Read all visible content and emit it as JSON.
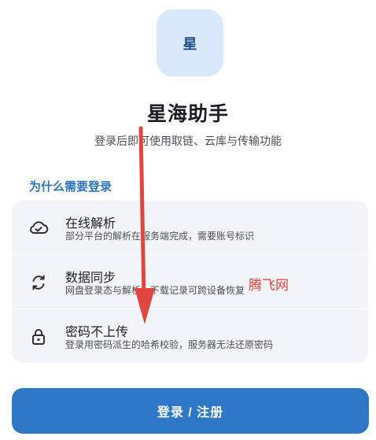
{
  "app": {
    "logo_char": "星",
    "title": "星海助手",
    "subtitle": "登录后即可使用取链、云库与传输功能"
  },
  "section": {
    "title": "为什么需要登录"
  },
  "features": [
    {
      "icon": "cloud-check-icon",
      "title": "在线解析",
      "desc": "部分平台的解析在服务端完成，需要账号标识"
    },
    {
      "icon": "sync-icon",
      "title": "数据同步",
      "desc": "网盘登录态与解析、下载记录可跨设备恢复"
    },
    {
      "icon": "lock-icon",
      "title": "密码不上传",
      "desc": "登录用密码派生的哈希校验，服务器无法还原密码"
    }
  ],
  "watermark": "腾飞网",
  "login_button": {
    "label": "登录 / 注册"
  },
  "colors": {
    "accent": "#2f78c8",
    "section_title": "#2d73b9",
    "logo_bg": "#d9e9fb",
    "card_bg": "#f1f5f9",
    "annotation_red": "#e0463f"
  }
}
